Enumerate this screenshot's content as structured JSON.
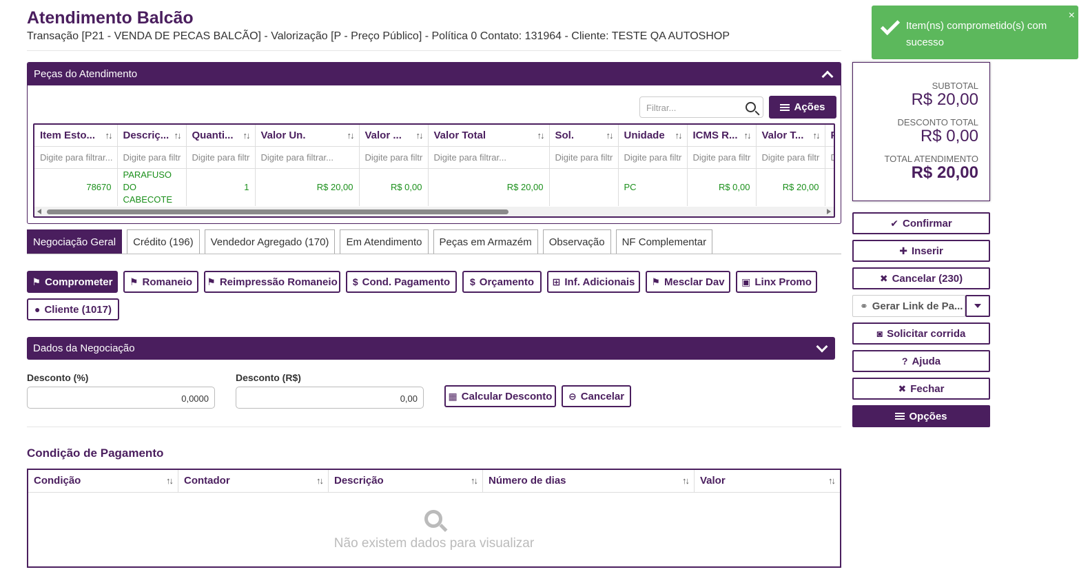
{
  "header": {
    "title": "Atendimento Balcão",
    "subtitle": "Transação [P21 - VENDA DE PECAS BALCÃO] - Valorização [P - Preço Público] - Política 0 Contato: 131964 - Cliente: TESTE QA AUTOSHOP"
  },
  "pecas_panel": {
    "title": "Peças do Atendimento",
    "filter_placeholder": "Filtrar...",
    "acoes_label": "Ações",
    "columns": [
      "Item Esto...",
      "Descriç...",
      "Quanti...",
      "Valor Un.",
      "Valor ...",
      "Valor Total",
      "Sol.",
      "Unidade",
      "ICMS R...",
      "Valor T...",
      "P"
    ],
    "filters": [
      "Digite para filtrar...",
      "Digite para filtr",
      "Digite para filtr",
      "Digite para filtrar...",
      "Digite para filtr",
      "Digite para filtrar...",
      "Digite para filtr",
      "Digite para filtr",
      "Digite para filtr",
      "Digite para filtr",
      "D"
    ],
    "row": {
      "item": "78670",
      "descricao": "PARAFUSO DO CABECOTE",
      "quantidade": "1",
      "valor_un": "R$ 20,00",
      "valor_desc": "R$ 0,00",
      "valor_total": "R$ 20,00",
      "sol": "",
      "unidade": "PC",
      "icms": "R$ 0,00",
      "valor_t": "R$ 20,00"
    }
  },
  "tabs": [
    "Negociação Geral",
    "Crédito (196)",
    "Vendedor Agregado (170)",
    "Em Atendimento",
    "Peças em Armazém",
    "Observação",
    "NF Complementar"
  ],
  "actions": {
    "comprometer": "Comprometer",
    "romaneio": "Romaneio",
    "reimpressao": "Reimpressão Romaneio",
    "cond_pagamento": "Cond. Pagamento",
    "orcamento": "Orçamento",
    "inf_adicionais": "Inf. Adicionais",
    "mesclar_dav": "Mesclar Dav",
    "linx_promo": "Linx Promo",
    "cliente": "Cliente (1017)"
  },
  "dados": {
    "title": "Dados da Negociação",
    "desconto_pct_label": "Desconto (%)",
    "desconto_pct_value": "0,0000",
    "desconto_rs_label": "Desconto (R$)",
    "desconto_rs_value": "0,00",
    "calcular_label": "Calcular Desconto",
    "cancelar_label": "Cancelar"
  },
  "condicao": {
    "title": "Condição de Pagamento",
    "columns": [
      "Condição",
      "Contador",
      "Descrição",
      "Número de dias",
      "Valor"
    ],
    "empty_text": "Não existem dados para visualizar"
  },
  "summary": {
    "subtotal_label": "SUBTOTAL",
    "subtotal_value": "R$ 20,00",
    "desconto_label": "DESCONTO TOTAL",
    "desconto_value": "R$ 0,00",
    "total_label": "TOTAL ATENDIMENTO",
    "total_value": "R$ 20,00"
  },
  "side_buttons": {
    "confirmar": "Confirmar",
    "inserir": "Inserir",
    "cancelar": "Cancelar (230)",
    "gerar_link": "Gerar Link de Pa...",
    "solicitar": "Solicitar corrida",
    "ajuda": "Ajuda",
    "fechar": "Fechar",
    "opcoes": "Opções"
  },
  "toast": {
    "message": "Item(ns) comprometido(s) com sucesso",
    "close": "×"
  },
  "colors": {
    "primary": "#4a1e5e",
    "success": "#5cb85c",
    "value_green": "#1a8f1a"
  }
}
